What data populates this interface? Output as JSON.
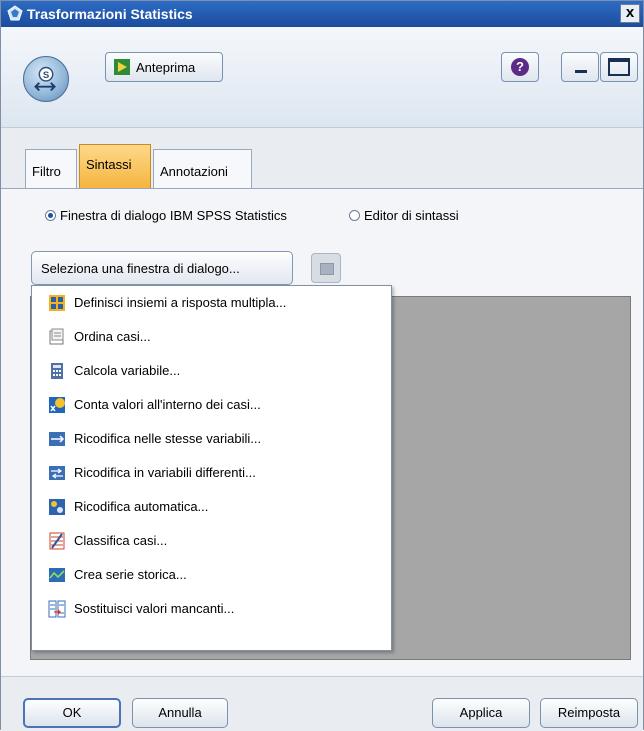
{
  "window": {
    "title": "Trasformazioni Statistics",
    "close_glyph": "x"
  },
  "toolbar": {
    "preview_label": "Anteprima",
    "help_glyph": "?"
  },
  "tabs": [
    {
      "label": "Filtro",
      "selected": false
    },
    {
      "label": "Sintassi",
      "selected": true
    },
    {
      "label": "Annotazioni",
      "selected": false
    }
  ],
  "mode": {
    "option_dialog": "Finestra di dialogo IBM SPSS Statistics",
    "option_editor": "Editor di sintassi",
    "selected": "option_dialog"
  },
  "select_dialog_label": "Seleziona una finestra di dialogo...",
  "menu": {
    "items": [
      {
        "label": "Definisci insiemi a risposta multipla...",
        "icon": "grid-icon"
      },
      {
        "label": "Ordina casi...",
        "icon": "sort-icon"
      },
      {
        "label": "Calcola variabile...",
        "icon": "calculator-icon"
      },
      {
        "label": "Conta valori all'interno dei casi...",
        "icon": "count-icon"
      },
      {
        "label": "Ricodifica nelle stesse variabili...",
        "icon": "recode-same-icon"
      },
      {
        "label": "Ricodifica in variabili differenti...",
        "icon": "recode-different-icon"
      },
      {
        "label": "Ricodifica automatica...",
        "icon": "auto-recode-icon"
      },
      {
        "label": "Classifica casi...",
        "icon": "rank-icon"
      },
      {
        "label": "Crea serie storica...",
        "icon": "time-series-icon"
      },
      {
        "label": "Sostituisci valori mancanti...",
        "icon": "replace-missing-icon"
      }
    ]
  },
  "buttons": {
    "ok": "OK",
    "cancel": "Annulla",
    "apply": "Applica",
    "reset": "Reimposta"
  },
  "colors": {
    "titlebar": "#1c4c9c",
    "selected_tab": "#f5b43c",
    "editor_background": "#a6a6a6"
  }
}
